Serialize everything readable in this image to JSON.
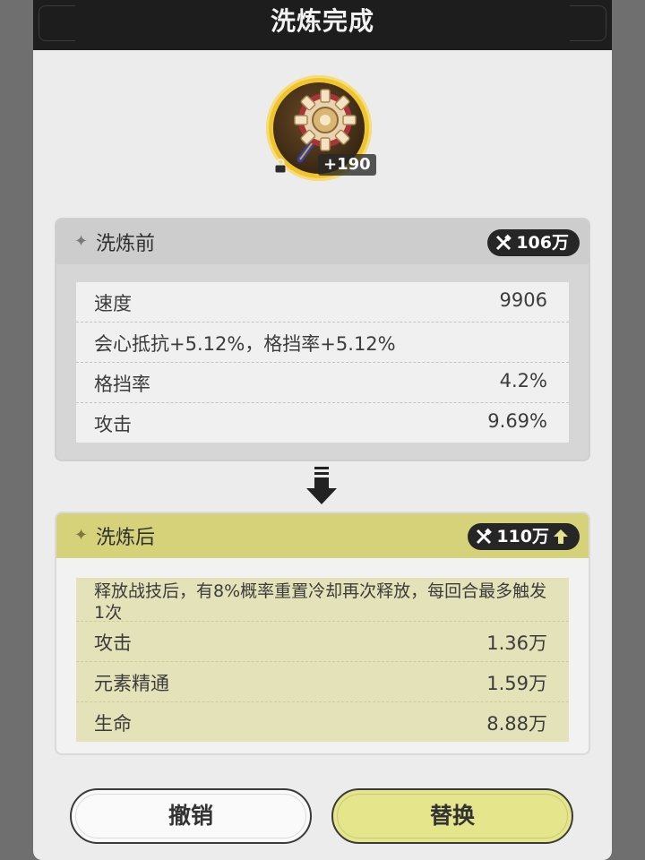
{
  "dialog": {
    "title": "洗炼完成"
  },
  "item": {
    "plus_level": "+190",
    "locked": true,
    "icon": "golden-gear-staff"
  },
  "before": {
    "title": "洗炼前",
    "score": "106万",
    "stats": [
      {
        "label": "速度",
        "value": "9906"
      },
      {
        "label": "会心抵抗+5.12%，格挡率+5.12%",
        "value": ""
      },
      {
        "label": "格挡率",
        "value": "4.2%"
      },
      {
        "label": "攻击",
        "value": "9.69%"
      }
    ]
  },
  "after": {
    "title": "洗炼后",
    "score": "110万",
    "stats": [
      {
        "label": "释放战技后，有8%概率重置冷却再次释放，每回合最多触发1次",
        "value": ""
      },
      {
        "label": "攻击",
        "value": "1.36万"
      },
      {
        "label": "元素精通",
        "value": "1.59万"
      },
      {
        "label": "生命",
        "value": "8.88万"
      }
    ]
  },
  "buttons": {
    "cancel": "撤销",
    "replace": "替换"
  },
  "colors": {
    "after_header": "#d6d27a",
    "replace_button": "#e5e58b",
    "item_ring": "#f0c42c"
  }
}
